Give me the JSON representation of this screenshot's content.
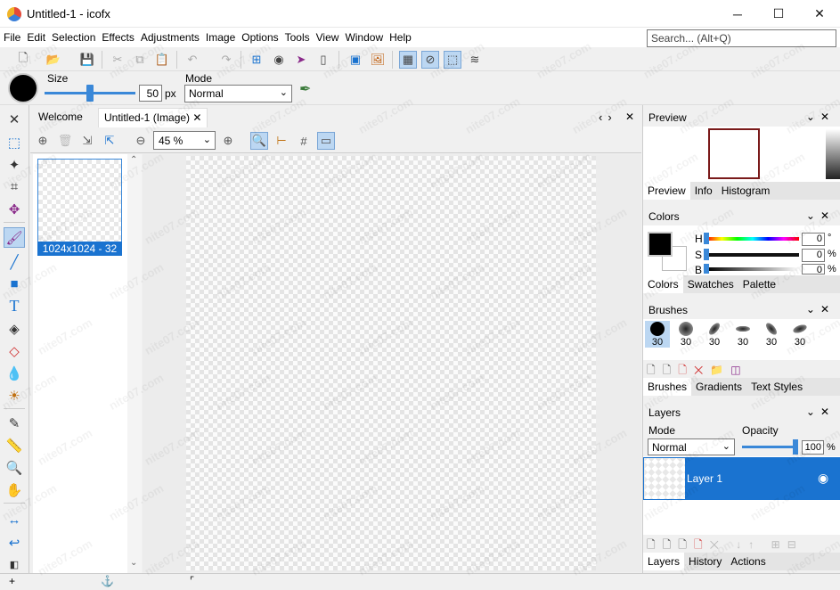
{
  "window": {
    "title": "Untitled-1 - icofx",
    "minimize": "─",
    "maximize": "☐",
    "close": "✕"
  },
  "menu": [
    "File",
    "Edit",
    "Selection",
    "Effects",
    "Adjustments",
    "Image",
    "Options",
    "Tools",
    "View",
    "Window",
    "Help"
  ],
  "search": {
    "placeholder": "Search... (Alt+Q)"
  },
  "options_bar": {
    "size_label": "Size",
    "size_value": "50",
    "size_unit": "px",
    "mode_label": "Mode",
    "mode_value": "Normal"
  },
  "doc_tabs": {
    "welcome": "Welcome",
    "active": "Untitled-1 (Image)",
    "close": "✕",
    "nav": "‹›"
  },
  "doc_toolbar": {
    "zoom": "45 %"
  },
  "page": {
    "label": "1024x1024 - 32"
  },
  "panels": {
    "preview": {
      "title": "Preview",
      "tabs": [
        "Preview",
        "Info",
        "Histogram"
      ]
    },
    "colors": {
      "title": "Colors",
      "tabs": [
        "Colors",
        "Swatches",
        "Palette"
      ],
      "channels": [
        {
          "name": "H",
          "value": "0",
          "unit": "°"
        },
        {
          "name": "S",
          "value": "0",
          "unit": "%"
        },
        {
          "name": "B",
          "value": "0",
          "unit": "%"
        }
      ]
    },
    "brushes": {
      "title": "Brushes",
      "tabs": [
        "Brushes",
        "Gradients",
        "Text Styles"
      ],
      "sizes": [
        "30",
        "30",
        "30",
        "30",
        "30",
        "30"
      ]
    },
    "layers": {
      "title": "Layers",
      "mode_label": "Mode",
      "mode_value": "Normal",
      "opacity_label": "Opacity",
      "opacity_value": "100",
      "opacity_unit": "%",
      "layer_name": "Layer 1",
      "tabs": [
        "Layers",
        "History",
        "Actions"
      ]
    }
  },
  "colors": {
    "accent": "#1a73d0",
    "selected_tool_bg": "#bcd7f2"
  },
  "watermark": "nite07.com"
}
